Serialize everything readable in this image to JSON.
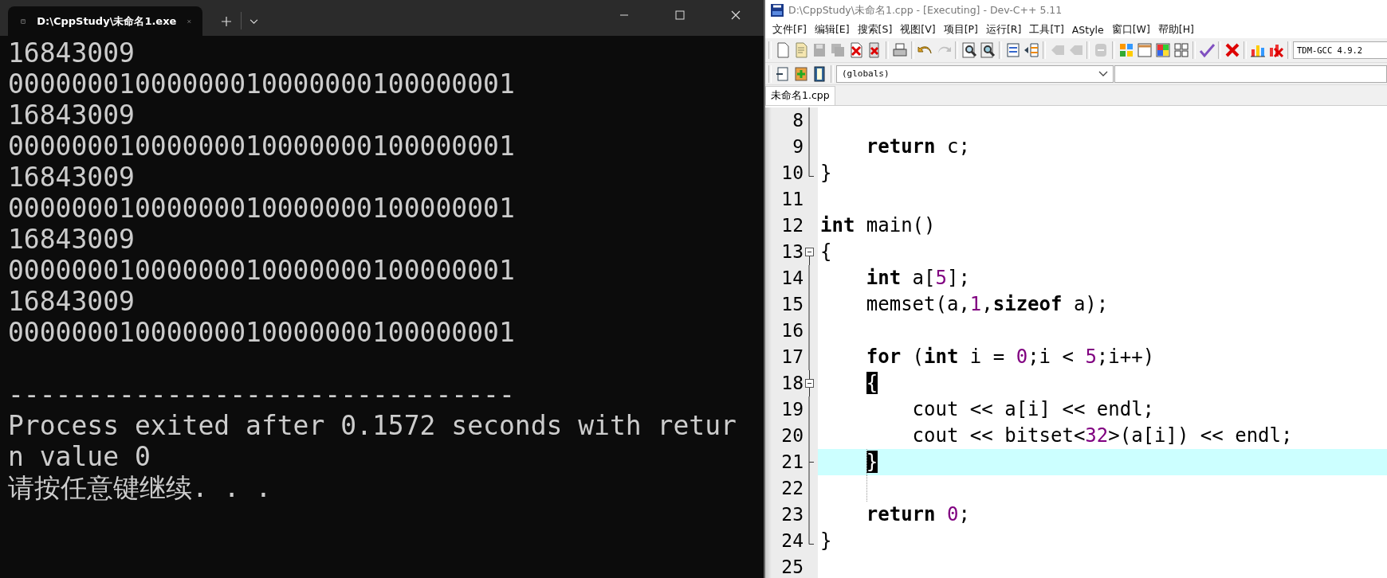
{
  "console_window": {
    "tab_title": "D:\\CppStudy\\未命名1.exe",
    "lines": [
      {
        "text": "16843009"
      },
      {
        "text": "00000001000000010000000100000001"
      },
      {
        "text": "16843009"
      },
      {
        "text": "00000001000000010000000100000001"
      },
      {
        "text": "16843009"
      },
      {
        "text": "00000001000000010000000100000001"
      },
      {
        "text": "16843009"
      },
      {
        "text": "00000001000000010000000100000001"
      },
      {
        "text": "16843009"
      },
      {
        "text": "00000001000000010000000100000001"
      },
      {
        "text": "--------------------------------",
        "blank_before": true
      },
      {
        "text": "Process exited after 0.1572 seconds with retur"
      },
      {
        "text": "n value 0"
      },
      {
        "text": "请按任意键继续. . ."
      }
    ]
  },
  "ide_window": {
    "title": "D:\\CppStudy\\未命名1.cpp - [Executing] - Dev-C++ 5.11",
    "menu": [
      "文件[F]",
      "编辑[E]",
      "搜索[S]",
      "视图[V]",
      "项目[P]",
      "运行[R]",
      "工具[T]",
      "AStyle",
      "窗口[W]",
      "帮助[H]"
    ],
    "toolbar": [
      [
        {
          "disabled": false
        },
        {
          "disabled": false
        },
        {
          "disabled": true
        },
        {
          "disabled": true
        },
        {
          "disabled": false
        },
        {
          "disabled": false
        }
      ],
      [
        {
          "disabled": false
        }
      ],
      [
        {
          "disabled": false
        },
        {
          "disabled": true
        }
      ],
      [
        {
          "disabled": false
        },
        {
          "disabled": false
        }
      ],
      [
        {
          "disabled": false
        },
        {
          "disabled": false
        }
      ],
      [
        {
          "disabled": true
        },
        {
          "disabled": true
        }
      ],
      [
        {
          "disabled": true
        }
      ],
      [
        {
          "disabled": false
        },
        {
          "disabled": false
        },
        {
          "disabled": false
        },
        {
          "disabled": false
        }
      ],
      [
        {
          "disabled": false
        }
      ],
      [
        {
          "disabled": false
        }
      ],
      [
        {
          "disabled": false
        },
        {
          "disabled": false
        }
      ]
    ],
    "compiler": "TDM-GCC 4.9.2",
    "scope": "(globals)",
    "tabs": [
      {
        "label": "未命名1.cpp",
        "selected": true
      }
    ],
    "code": [
      {
        "number": "8",
        "in_fold": true,
        "fold_toggle": false,
        "fold_end": false,
        "current": false
      },
      {
        "number": "9",
        "in_fold": true,
        "fold_toggle": false,
        "fold_end": false,
        "current": false,
        "tokens": [
          {
            "kind": "keyword",
            "text": "    return"
          },
          {
            "kind": "plain",
            "text": " c;"
          }
        ]
      },
      {
        "number": "10",
        "in_fold": false,
        "fold_toggle": false,
        "fold_end": true,
        "current": false,
        "tokens": [
          {
            "kind": "plain",
            "text": "}"
          }
        ]
      },
      {
        "number": "11",
        "in_fold": false,
        "fold_toggle": false,
        "fold_end": false,
        "current": false
      },
      {
        "number": "12",
        "in_fold": false,
        "fold_toggle": false,
        "fold_end": false,
        "current": false,
        "tokens": [
          {
            "kind": "keyword",
            "text": "int"
          },
          {
            "kind": "plain",
            "text": " main()"
          }
        ]
      },
      {
        "number": "13",
        "in_fold": false,
        "fold_toggle": true,
        "fold_end": false,
        "current": false,
        "tokens": [
          {
            "kind": "plain",
            "text": "{"
          }
        ]
      },
      {
        "number": "14",
        "in_fold": true,
        "fold_toggle": false,
        "fold_end": false,
        "current": false,
        "tokens": [
          {
            "kind": "keyword",
            "text": "    int"
          },
          {
            "kind": "plain",
            "text": " a["
          },
          {
            "kind": "number",
            "text": "5"
          },
          {
            "kind": "plain",
            "text": "];"
          }
        ]
      },
      {
        "number": "15",
        "in_fold": true,
        "fold_toggle": false,
        "fold_end": false,
        "current": false,
        "tokens": [
          {
            "kind": "plain",
            "text": "    memset(a,"
          },
          {
            "kind": "number",
            "text": "1"
          },
          {
            "kind": "plain",
            "text": ","
          },
          {
            "kind": "keyword",
            "text": "sizeof"
          },
          {
            "kind": "plain",
            "text": " a);"
          }
        ]
      },
      {
        "number": "16",
        "in_fold": true,
        "fold_toggle": false,
        "fold_end": false,
        "current": false
      },
      {
        "number": "17",
        "in_fold": true,
        "fold_toggle": false,
        "fold_end": false,
        "current": false,
        "tokens": [
          {
            "kind": "keyword",
            "text": "    for"
          },
          {
            "kind": "plain",
            "text": " ("
          },
          {
            "kind": "keyword",
            "text": "int"
          },
          {
            "kind": "plain",
            "text": " i = "
          },
          {
            "kind": "number",
            "text": "0"
          },
          {
            "kind": "plain",
            "text": ";i < "
          },
          {
            "kind": "number",
            "text": "5"
          },
          {
            "kind": "plain",
            "text": ";i++)"
          }
        ]
      },
      {
        "number": "18",
        "in_fold": true,
        "fold_toggle": true,
        "fold_end": false,
        "current": false,
        "tokens": [
          {
            "kind": "brace_match",
            "text": "    {"
          }
        ]
      },
      {
        "number": "19",
        "in_fold": true,
        "fold_toggle": false,
        "fold_end": false,
        "current": false,
        "tokens": [
          {
            "kind": "plain",
            "text": "        cout << a[i] << endl;"
          }
        ]
      },
      {
        "number": "20",
        "in_fold": true,
        "fold_toggle": false,
        "fold_end": false,
        "current": false,
        "tokens": [
          {
            "kind": "plain",
            "text": "        cout << bitset<"
          },
          {
            "kind": "number",
            "text": "32"
          },
          {
            "kind": "plain",
            "text": ">(a[i]) << endl;"
          }
        ]
      },
      {
        "number": "21",
        "in_fold": true,
        "fold_toggle": false,
        "fold_end": true,
        "current": true,
        "tokens": [
          {
            "kind": "brace_match",
            "text": "    }"
          }
        ]
      },
      {
        "number": "22",
        "in_fold": true,
        "fold_toggle": false,
        "fold_end": false,
        "current": false
      },
      {
        "number": "23",
        "in_fold": true,
        "fold_toggle": false,
        "fold_end": false,
        "current": false,
        "tokens": [
          {
            "kind": "keyword",
            "text": "    return "
          },
          {
            "kind": "number",
            "text": "0"
          },
          {
            "kind": "plain",
            "text": ";"
          }
        ]
      },
      {
        "number": "24",
        "in_fold": false,
        "fold_toggle": false,
        "fold_end": true,
        "current": false,
        "tokens": [
          {
            "kind": "plain",
            "text": "}"
          }
        ]
      },
      {
        "number": "25",
        "in_fold": false,
        "fold_toggle": false,
        "fold_end": false,
        "current": false
      }
    ]
  }
}
